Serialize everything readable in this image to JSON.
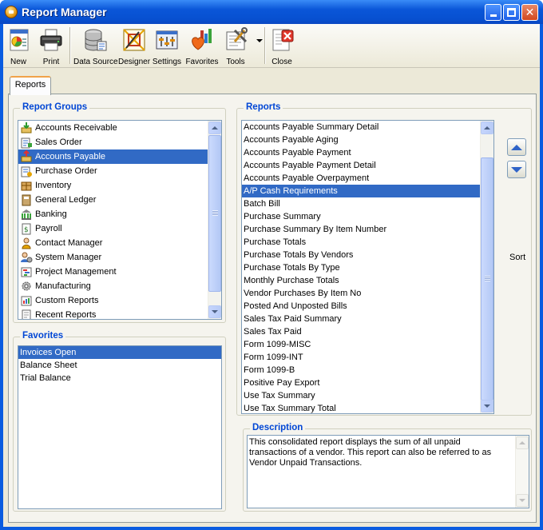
{
  "window": {
    "title": "Report Manager",
    "controls": {
      "minimize": "minimize",
      "maximize": "maximize",
      "close": "close"
    }
  },
  "toolbar": {
    "buttons": [
      {
        "label": "New",
        "icon": "new-report-icon"
      },
      {
        "label": "Print",
        "icon": "printer-icon"
      },
      {
        "label": "Data Source",
        "icon": "database-icon"
      },
      {
        "label": "Designer",
        "icon": "designer-icon"
      },
      {
        "label": "Settings",
        "icon": "settings-icon"
      },
      {
        "label": "Favorites",
        "icon": "favorites-icon"
      },
      {
        "label": "Tools",
        "icon": "tools-icon"
      },
      {
        "label": "Close",
        "icon": "close-report-icon"
      }
    ]
  },
  "tabs": [
    {
      "label": "Reports",
      "active": true
    }
  ],
  "report_groups": {
    "title": "Report Groups",
    "selected": "Accounts Payable",
    "items": [
      {
        "label": "Accounts Receivable",
        "icon": "accounts-receivable-icon"
      },
      {
        "label": "Sales Order",
        "icon": "sales-order-icon"
      },
      {
        "label": "Accounts Payable",
        "icon": "accounts-payable-icon"
      },
      {
        "label": "Purchase Order",
        "icon": "purchase-order-icon"
      },
      {
        "label": "Inventory",
        "icon": "inventory-icon"
      },
      {
        "label": "General Ledger",
        "icon": "general-ledger-icon"
      },
      {
        "label": "Banking",
        "icon": "banking-icon"
      },
      {
        "label": "Payroll",
        "icon": "payroll-icon"
      },
      {
        "label": "Contact Manager",
        "icon": "contact-manager-icon"
      },
      {
        "label": "System Manager",
        "icon": "system-manager-icon"
      },
      {
        "label": "Project Management",
        "icon": "project-management-icon"
      },
      {
        "label": "Manufacturing",
        "icon": "manufacturing-icon"
      },
      {
        "label": "Custom Reports",
        "icon": "custom-reports-icon"
      },
      {
        "label": "Recent Reports",
        "icon": "recent-reports-icon"
      }
    ]
  },
  "favorites": {
    "title": "Favorites",
    "selected": "Invoices Open",
    "items": [
      "Invoices Open",
      "Balance Sheet",
      "Trial Balance"
    ]
  },
  "reports": {
    "title": "Reports",
    "selected": "A/P Cash Requirements",
    "items": [
      "Accounts Payable Summary Detail",
      "Accounts Payable Aging",
      "Accounts Payable Payment",
      "Accounts Payable Payment Detail",
      "Accounts Payable Overpayment",
      "A/P Cash Requirements",
      "Batch Bill",
      "Purchase Summary",
      "Purchase Summary By Item Number",
      "Purchase Totals",
      "Purchase Totals By Vendors",
      "Purchase Totals By Type",
      "Monthly Purchase Totals",
      "Vendor Purchases By Item No",
      "Posted And Unposted Bills",
      "Sales Tax Paid Summary",
      "Sales Tax Paid",
      "Form 1099-MISC",
      "Form 1099-INT",
      "Form 1099-B",
      "Positive Pay Export",
      "Use Tax Summary",
      "Use Tax Summary Total"
    ]
  },
  "sort": {
    "label": "Sort"
  },
  "description": {
    "title": "Description",
    "text": "This consolidated report displays the sum of all unpaid transactions of a vendor. This report can also be referred to as Vendor Unpaid Transactions."
  },
  "colors": {
    "selection": "#316ac5",
    "group_title": "#0046d5",
    "titlebar": "#0a56d8"
  }
}
